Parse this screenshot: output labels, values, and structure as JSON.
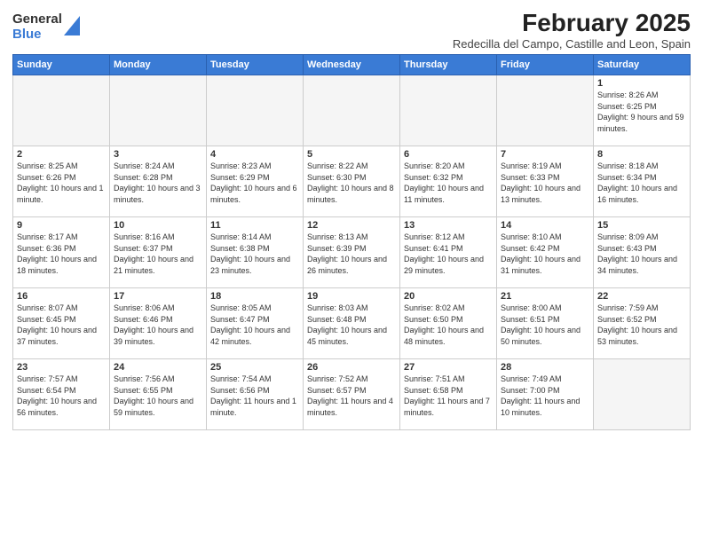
{
  "logo": {
    "general": "General",
    "blue": "Blue"
  },
  "title": "February 2025",
  "location": "Redecilla del Campo, Castille and Leon, Spain",
  "weekdays": [
    "Sunday",
    "Monday",
    "Tuesday",
    "Wednesday",
    "Thursday",
    "Friday",
    "Saturday"
  ],
  "days": [
    {
      "num": "",
      "info": ""
    },
    {
      "num": "",
      "info": ""
    },
    {
      "num": "",
      "info": ""
    },
    {
      "num": "",
      "info": ""
    },
    {
      "num": "",
      "info": ""
    },
    {
      "num": "",
      "info": ""
    },
    {
      "num": "1",
      "info": "Sunrise: 8:26 AM\nSunset: 6:25 PM\nDaylight: 9 hours and 59 minutes."
    },
    {
      "num": "2",
      "info": "Sunrise: 8:25 AM\nSunset: 6:26 PM\nDaylight: 10 hours and 1 minute."
    },
    {
      "num": "3",
      "info": "Sunrise: 8:24 AM\nSunset: 6:28 PM\nDaylight: 10 hours and 3 minutes."
    },
    {
      "num": "4",
      "info": "Sunrise: 8:23 AM\nSunset: 6:29 PM\nDaylight: 10 hours and 6 minutes."
    },
    {
      "num": "5",
      "info": "Sunrise: 8:22 AM\nSunset: 6:30 PM\nDaylight: 10 hours and 8 minutes."
    },
    {
      "num": "6",
      "info": "Sunrise: 8:20 AM\nSunset: 6:32 PM\nDaylight: 10 hours and 11 minutes."
    },
    {
      "num": "7",
      "info": "Sunrise: 8:19 AM\nSunset: 6:33 PM\nDaylight: 10 hours and 13 minutes."
    },
    {
      "num": "8",
      "info": "Sunrise: 8:18 AM\nSunset: 6:34 PM\nDaylight: 10 hours and 16 minutes."
    },
    {
      "num": "9",
      "info": "Sunrise: 8:17 AM\nSunset: 6:36 PM\nDaylight: 10 hours and 18 minutes."
    },
    {
      "num": "10",
      "info": "Sunrise: 8:16 AM\nSunset: 6:37 PM\nDaylight: 10 hours and 21 minutes."
    },
    {
      "num": "11",
      "info": "Sunrise: 8:14 AM\nSunset: 6:38 PM\nDaylight: 10 hours and 23 minutes."
    },
    {
      "num": "12",
      "info": "Sunrise: 8:13 AM\nSunset: 6:39 PM\nDaylight: 10 hours and 26 minutes."
    },
    {
      "num": "13",
      "info": "Sunrise: 8:12 AM\nSunset: 6:41 PM\nDaylight: 10 hours and 29 minutes."
    },
    {
      "num": "14",
      "info": "Sunrise: 8:10 AM\nSunset: 6:42 PM\nDaylight: 10 hours and 31 minutes."
    },
    {
      "num": "15",
      "info": "Sunrise: 8:09 AM\nSunset: 6:43 PM\nDaylight: 10 hours and 34 minutes."
    },
    {
      "num": "16",
      "info": "Sunrise: 8:07 AM\nSunset: 6:45 PM\nDaylight: 10 hours and 37 minutes."
    },
    {
      "num": "17",
      "info": "Sunrise: 8:06 AM\nSunset: 6:46 PM\nDaylight: 10 hours and 39 minutes."
    },
    {
      "num": "18",
      "info": "Sunrise: 8:05 AM\nSunset: 6:47 PM\nDaylight: 10 hours and 42 minutes."
    },
    {
      "num": "19",
      "info": "Sunrise: 8:03 AM\nSunset: 6:48 PM\nDaylight: 10 hours and 45 minutes."
    },
    {
      "num": "20",
      "info": "Sunrise: 8:02 AM\nSunset: 6:50 PM\nDaylight: 10 hours and 48 minutes."
    },
    {
      "num": "21",
      "info": "Sunrise: 8:00 AM\nSunset: 6:51 PM\nDaylight: 10 hours and 50 minutes."
    },
    {
      "num": "22",
      "info": "Sunrise: 7:59 AM\nSunset: 6:52 PM\nDaylight: 10 hours and 53 minutes."
    },
    {
      "num": "23",
      "info": "Sunrise: 7:57 AM\nSunset: 6:54 PM\nDaylight: 10 hours and 56 minutes."
    },
    {
      "num": "24",
      "info": "Sunrise: 7:56 AM\nSunset: 6:55 PM\nDaylight: 10 hours and 59 minutes."
    },
    {
      "num": "25",
      "info": "Sunrise: 7:54 AM\nSunset: 6:56 PM\nDaylight: 11 hours and 1 minute."
    },
    {
      "num": "26",
      "info": "Sunrise: 7:52 AM\nSunset: 6:57 PM\nDaylight: 11 hours and 4 minutes."
    },
    {
      "num": "27",
      "info": "Sunrise: 7:51 AM\nSunset: 6:58 PM\nDaylight: 11 hours and 7 minutes."
    },
    {
      "num": "28",
      "info": "Sunrise: 7:49 AM\nSunset: 7:00 PM\nDaylight: 11 hours and 10 minutes."
    },
    {
      "num": "",
      "info": ""
    }
  ]
}
